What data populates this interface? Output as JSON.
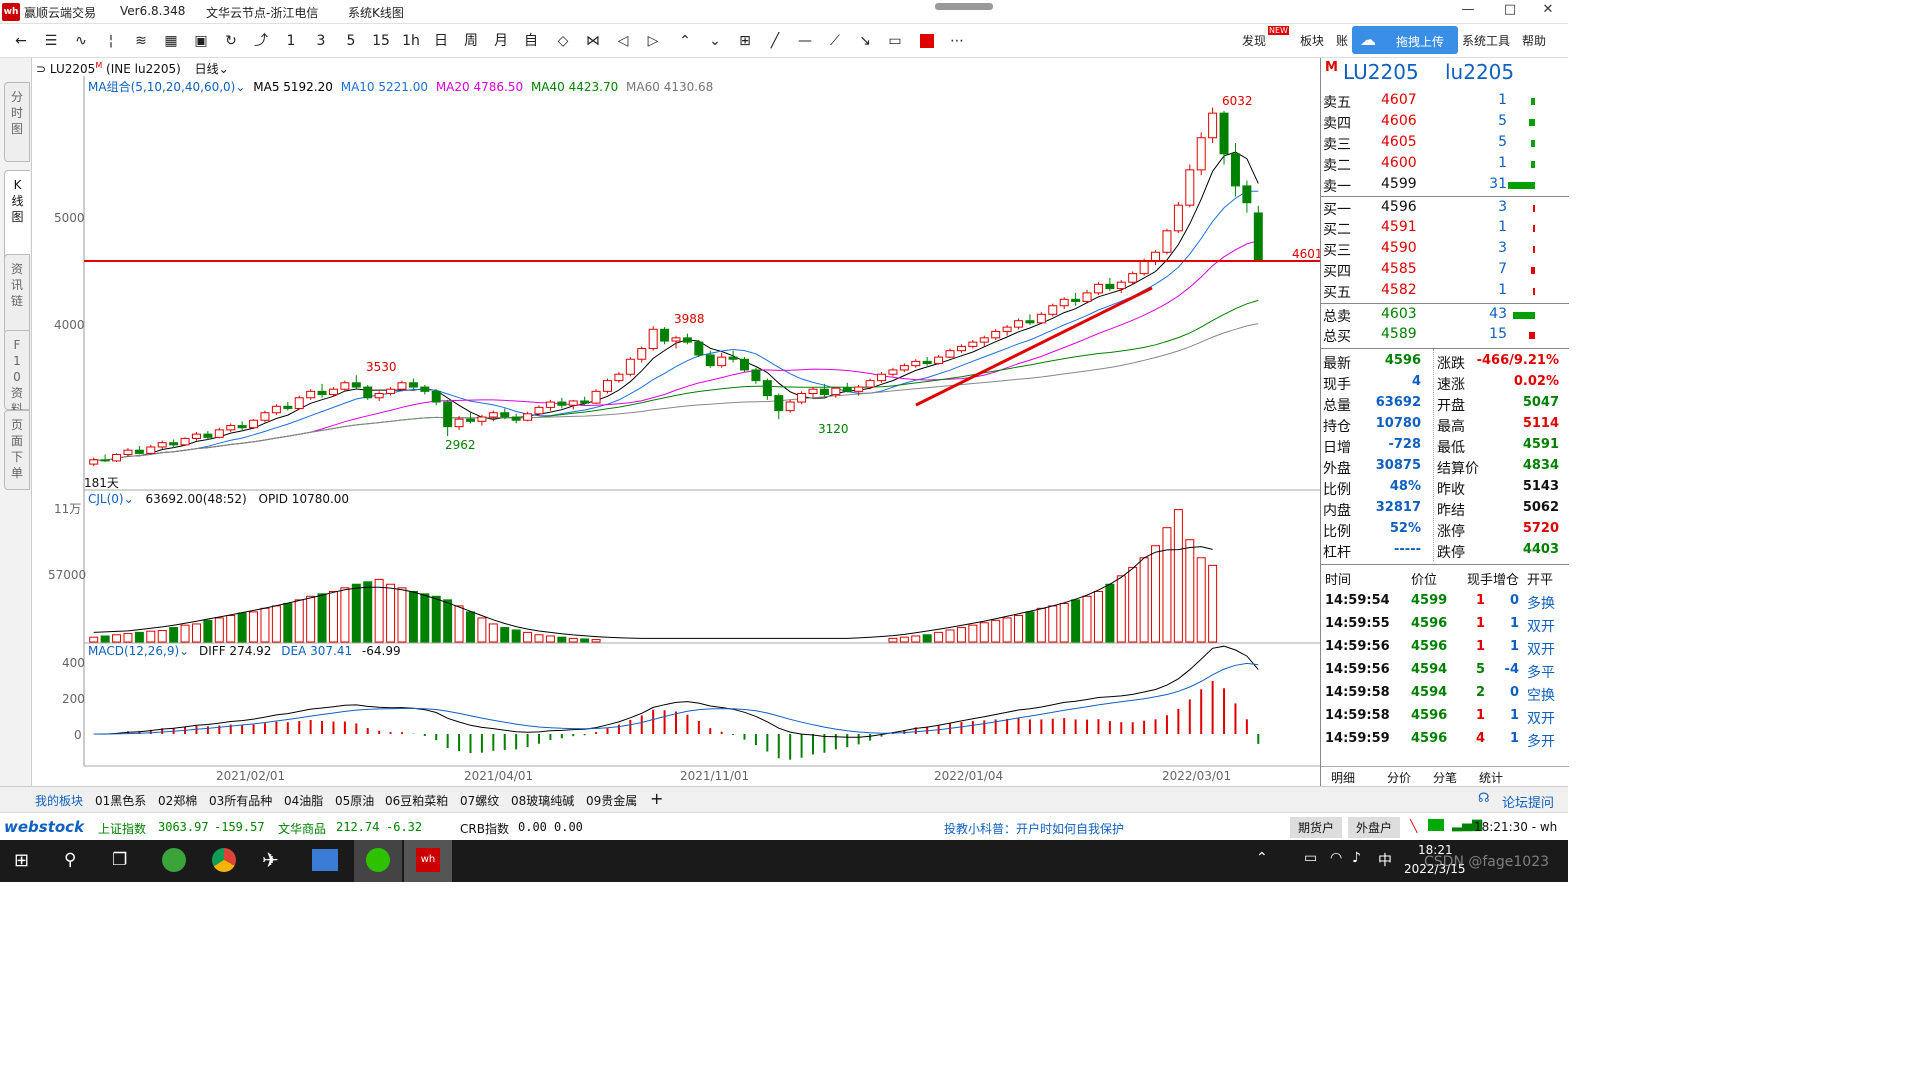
{
  "titlebar": {
    "app": "赢顺云端交易",
    "version": "Ver6.8.348",
    "server": "文华云节点-浙江电信",
    "view": "系统K线图",
    "minimize": "—",
    "maximize": "□",
    "close": "✕"
  },
  "toolbar": {
    "icons": [
      "back-arrow",
      "list",
      "line-chart",
      "candle",
      "fenshi",
      "calc",
      "save",
      "refresh",
      "rise"
    ],
    "periods": [
      "1",
      "3",
      "5",
      "15",
      "1h",
      "日",
      "周",
      "月",
      "自"
    ],
    "right": {
      "discover": "发现",
      "new_badge": "NEW",
      "sector": "板块",
      "account": "账",
      "upload": "拖拽上传",
      "tools": "系统工具",
      "help": "帮助"
    }
  },
  "lefttabs": [
    "分时图",
    "K线图",
    "资讯链",
    "F10资料",
    "页面下单"
  ],
  "main": {
    "header": {
      "symbol": "LU2205",
      "sup": "M",
      "name": "(INE lu2205)",
      "period": "日线"
    },
    "ma": {
      "label": "MA组合(5,10,20,40,60,0)",
      "ma5": "MA5 5192.20",
      "ma10": "MA10 5221.00",
      "ma20": "MA20 4786.50",
      "ma40": "MA40 4423.70",
      "ma60": "MA60 4130.68"
    },
    "price_axis": [
      "5000",
      "4000"
    ],
    "annotations": {
      "high": "6032",
      "a1": "3530",
      "a2": "2962",
      "a3": "3988",
      "a4": "3120",
      "hline": "4601",
      "days": "181天"
    },
    "vol": {
      "label": "CJL(0)",
      "value": "63692.00(48:52)",
      "opid": "OPID 10780.00",
      "axis": [
        "11万",
        "57000"
      ]
    },
    "macd": {
      "label": "MACD(12,26,9)",
      "diff": "DIFF 274.92",
      "dea": "DEA 307.41",
      "macd": "-64.99",
      "axis": [
        "400",
        "200",
        "0"
      ]
    },
    "dates": [
      "2021/02/01",
      "2021/04/01",
      "2021/11/01",
      "2022/01/04",
      "2022/03/01"
    ]
  },
  "quote": {
    "code": "LU2205",
    "name": "lu2205",
    "m": "M",
    "asks": [
      {
        "l": "卖五",
        "p": "4607",
        "v": "1"
      },
      {
        "l": "卖四",
        "p": "4606",
        "v": "5"
      },
      {
        "l": "卖三",
        "p": "4605",
        "v": "5"
      },
      {
        "l": "卖二",
        "p": "4600",
        "v": "1"
      },
      {
        "l": "卖一",
        "p": "4599",
        "v": "31"
      }
    ],
    "bids": [
      {
        "l": "买一",
        "p": "4596",
        "v": "3"
      },
      {
        "l": "买二",
        "p": "4591",
        "v": "1"
      },
      {
        "l": "买三",
        "p": "4590",
        "v": "3"
      },
      {
        "l": "买四",
        "p": "4585",
        "v": "7"
      },
      {
        "l": "买五",
        "p": "4582",
        "v": "1"
      }
    ],
    "total_sell": {
      "l": "总卖",
      "p": "4603",
      "v": "43"
    },
    "total_buy": {
      "l": "总买",
      "p": "4589",
      "v": "15"
    },
    "stats_left": [
      {
        "l": "最新",
        "v": "4596"
      },
      {
        "l": "现手",
        "v": "4"
      },
      {
        "l": "总量",
        "v": "63692"
      },
      {
        "l": "持仓",
        "v": "10780"
      },
      {
        "l": "日增",
        "v": "-728"
      },
      {
        "l": "外盘",
        "v": "30875"
      },
      {
        "l": "比例",
        "v": "48%"
      },
      {
        "l": "内盘",
        "v": "32817"
      },
      {
        "l": "比例",
        "v": "52%"
      },
      {
        "l": "杠杆",
        "v": "-----"
      }
    ],
    "stats_right": [
      {
        "l": "涨跌",
        "v": "-466/9.21%"
      },
      {
        "l": "速涨",
        "v": "0.02%"
      },
      {
        "l": "开盘",
        "v": "5047"
      },
      {
        "l": "最高",
        "v": "5114"
      },
      {
        "l": "最低",
        "v": "4591"
      },
      {
        "l": "结算价",
        "v": "4834"
      },
      {
        "l": "昨收",
        "v": "5143"
      },
      {
        "l": "昨结",
        "v": "5062"
      },
      {
        "l": "涨停",
        "v": "5720"
      },
      {
        "l": "跌停",
        "v": "4403"
      }
    ],
    "tick_header": [
      "时间",
      "价位",
      "现手",
      "增仓",
      "开平"
    ],
    "ticks": [
      [
        "14:59:54",
        "4599",
        "1",
        "0",
        "多换"
      ],
      [
        "14:59:55",
        "4596",
        "1",
        "1",
        "双开"
      ],
      [
        "14:59:56",
        "4596",
        "1",
        "1",
        "双开"
      ],
      [
        "14:59:56",
        "4594",
        "5",
        "-4",
        "多平"
      ],
      [
        "14:59:58",
        "4594",
        "2",
        "0",
        "空换"
      ],
      [
        "14:59:58",
        "4596",
        "1",
        "1",
        "双开"
      ],
      [
        "14:59:59",
        "4596",
        "4",
        "1",
        "多开"
      ]
    ],
    "bottom_tabs": [
      "明细",
      "分价",
      "分笔",
      "统计"
    ]
  },
  "bottomtabs": {
    "items": [
      "我的板块",
      "01黑色系",
      "02郑棉",
      "03所有品种",
      "04油脂",
      "05原油",
      "06豆粕菜粕",
      "07螺纹",
      "08玻璃纯碱",
      "09贵金属"
    ],
    "add": "+",
    "forum": "论坛提问"
  },
  "ticker": {
    "logo": "webstock",
    "idx1": "上证指数",
    "v1": "3063.97",
    "c1": "-159.57",
    "idx2": "文华商品",
    "v2": "212.74",
    "c2": "-6.32",
    "idx3": "CRB指数",
    "v3": "0.00",
    "c3": "0.00",
    "tip": "投教小科普：开户时如何自我保护",
    "btn1": "期货户",
    "btn2": "外盘户",
    "time": "18:21:30 - wh"
  },
  "taskbar": {
    "time": "18:21",
    "date": "2022/3/15",
    "ime": "中",
    "watermark": "CSDN @fage1023"
  },
  "chart_data": {
    "type": "candlestick",
    "symbol": "LU2205",
    "period": "日线",
    "yaxis_labels": [
      5000,
      4000
    ],
    "horizontal_line": 4601,
    "peak_label": 6032,
    "labels": [
      3530,
      2962,
      3988,
      3120
    ],
    "x_labels": [
      "2021/02/01",
      "2021/04/01",
      "2021/11/01",
      "2022/01/04",
      "2022/03/01"
    ],
    "ohlc": [
      [
        2700,
        2760,
        2680,
        2740
      ],
      [
        2740,
        2790,
        2720,
        2730
      ],
      [
        2730,
        2800,
        2720,
        2790
      ],
      [
        2790,
        2850,
        2770,
        2830
      ],
      [
        2830,
        2870,
        2790,
        2800
      ],
      [
        2800,
        2880,
        2790,
        2860
      ],
      [
        2860,
        2920,
        2840,
        2900
      ],
      [
        2900,
        2930,
        2850,
        2880
      ],
      [
        2880,
        2950,
        2870,
        2940
      ],
      [
        2940,
        3000,
        2920,
        2980
      ],
      [
        2980,
        3010,
        2930,
        2950
      ],
      [
        2950,
        3040,
        2940,
        3020
      ],
      [
        3020,
        3080,
        3000,
        3060
      ],
      [
        3060,
        3100,
        3010,
        3040
      ],
      [
        3040,
        3120,
        3030,
        3110
      ],
      [
        3110,
        3200,
        3090,
        3180
      ],
      [
        3180,
        3260,
        3160,
        3240
      ],
      [
        3240,
        3280,
        3200,
        3220
      ],
      [
        3220,
        3340,
        3210,
        3320
      ],
      [
        3320,
        3400,
        3300,
        3380
      ],
      [
        3380,
        3450,
        3320,
        3350
      ],
      [
        3350,
        3420,
        3330,
        3400
      ],
      [
        3400,
        3480,
        3380,
        3460
      ],
      [
        3460,
        3530,
        3400,
        3420
      ],
      [
        3420,
        3440,
        3300,
        3320
      ],
      [
        3320,
        3380,
        3290,
        3360
      ],
      [
        3360,
        3420,
        3340,
        3400
      ],
      [
        3400,
        3480,
        3380,
        3460
      ],
      [
        3460,
        3500,
        3400,
        3420
      ],
      [
        3420,
        3440,
        3350,
        3380
      ],
      [
        3380,
        3400,
        3250,
        3280
      ],
      [
        3280,
        3300,
        2962,
        3050
      ],
      [
        3050,
        3150,
        3020,
        3120
      ],
      [
        3120,
        3180,
        3080,
        3100
      ],
      [
        3100,
        3160,
        3060,
        3140
      ],
      [
        3140,
        3200,
        3100,
        3180
      ],
      [
        3180,
        3220,
        3120,
        3140
      ],
      [
        3140,
        3170,
        3080,
        3110
      ],
      [
        3110,
        3190,
        3100,
        3170
      ],
      [
        3170,
        3250,
        3150,
        3230
      ],
      [
        3230,
        3300,
        3200,
        3280
      ],
      [
        3280,
        3320,
        3220,
        3250
      ],
      [
        3250,
        3300,
        3210,
        3290
      ],
      [
        3290,
        3330,
        3250,
        3270
      ],
      [
        3270,
        3400,
        3260,
        3380
      ],
      [
        3380,
        3500,
        3360,
        3480
      ],
      [
        3480,
        3560,
        3460,
        3540
      ],
      [
        3540,
        3700,
        3520,
        3680
      ],
      [
        3680,
        3800,
        3650,
        3780
      ],
      [
        3780,
        3988,
        3760,
        3960
      ],
      [
        3960,
        3980,
        3820,
        3850
      ],
      [
        3850,
        3900,
        3780,
        3880
      ],
      [
        3880,
        3920,
        3820,
        3840
      ],
      [
        3840,
        3860,
        3700,
        3720
      ],
      [
        3720,
        3760,
        3600,
        3620
      ],
      [
        3620,
        3740,
        3600,
        3700
      ],
      [
        3700,
        3760,
        3650,
        3680
      ],
      [
        3680,
        3700,
        3560,
        3580
      ],
      [
        3580,
        3600,
        3450,
        3480
      ],
      [
        3480,
        3500,
        3300,
        3340
      ],
      [
        3340,
        3360,
        3120,
        3200
      ],
      [
        3200,
        3300,
        3180,
        3280
      ],
      [
        3280,
        3380,
        3260,
        3360
      ],
      [
        3360,
        3420,
        3320,
        3400
      ],
      [
        3400,
        3450,
        3330,
        3350
      ],
      [
        3350,
        3420,
        3320,
        3410
      ],
      [
        3410,
        3460,
        3370,
        3380
      ],
      [
        3380,
        3440,
        3340,
        3420
      ],
      [
        3420,
        3500,
        3400,
        3480
      ],
      [
        3480,
        3560,
        3460,
        3540
      ],
      [
        3540,
        3600,
        3520,
        3580
      ],
      [
        3580,
        3640,
        3560,
        3620
      ],
      [
        3620,
        3680,
        3600,
        3660
      ],
      [
        3660,
        3700,
        3620,
        3640
      ],
      [
        3640,
        3720,
        3630,
        3700
      ],
      [
        3700,
        3780,
        3690,
        3760
      ],
      [
        3760,
        3820,
        3740,
        3800
      ],
      [
        3800,
        3860,
        3780,
        3840
      ],
      [
        3840,
        3900,
        3800,
        3880
      ],
      [
        3880,
        3960,
        3860,
        3940
      ],
      [
        3940,
        4000,
        3900,
        3980
      ],
      [
        3980,
        4060,
        3960,
        4040
      ],
      [
        4040,
        4100,
        4000,
        4020
      ],
      [
        4020,
        4120,
        4010,
        4100
      ],
      [
        4100,
        4200,
        4080,
        4180
      ],
      [
        4180,
        4260,
        4150,
        4240
      ],
      [
        4240,
        4300,
        4180,
        4220
      ],
      [
        4220,
        4330,
        4200,
        4300
      ],
      [
        4300,
        4400,
        4280,
        4380
      ],
      [
        4380,
        4440,
        4320,
        4340
      ],
      [
        4340,
        4420,
        4300,
        4400
      ],
      [
        4400,
        4500,
        4380,
        4480
      ],
      [
        4480,
        4620,
        4460,
        4600
      ],
      [
        4600,
        4700,
        4560,
        4680
      ],
      [
        4680,
        4900,
        4660,
        4880
      ],
      [
        4880,
        5150,
        4860,
        5120
      ],
      [
        5120,
        5500,
        5100,
        5450
      ],
      [
        5450,
        5800,
        5400,
        5750
      ],
      [
        5750,
        6032,
        5700,
        5980
      ],
      [
        5980,
        6000,
        5500,
        5600
      ],
      [
        5600,
        5700,
        5200,
        5300
      ],
      [
        5300,
        5350,
        5050,
        5143
      ],
      [
        5047,
        5114,
        4591,
        4596
      ]
    ],
    "volume": [
      4000,
      5000,
      6000,
      7000,
      8000,
      9000,
      9500,
      12000,
      14000,
      15000,
      18000,
      20000,
      22000,
      24000,
      25000,
      28000,
      30000,
      32000,
      35000,
      38000,
      40000,
      42000,
      45000,
      48000,
      50000,
      52000,
      48000,
      45000,
      42000,
      40000,
      38000,
      35000,
      30000,
      25000,
      20000,
      15000,
      12000,
      10000,
      8000,
      6000,
      5000,
      4000,
      3000,
      2500,
      2000,
      0,
      0,
      0,
      0,
      0,
      0,
      0,
      0,
      0,
      0,
      0,
      0,
      0,
      0,
      0,
      0,
      0,
      0,
      0,
      0,
      0,
      0,
      0,
      0,
      0,
      3000,
      4000,
      5000,
      6000,
      8000,
      10000,
      12000,
      14000,
      16000,
      18000,
      20000,
      22000,
      25000,
      28000,
      30000,
      32000,
      35000,
      38000,
      42000,
      48000,
      55000,
      62000,
      70000,
      80000,
      95000,
      110000,
      85000,
      70000,
      63692
    ]
  }
}
